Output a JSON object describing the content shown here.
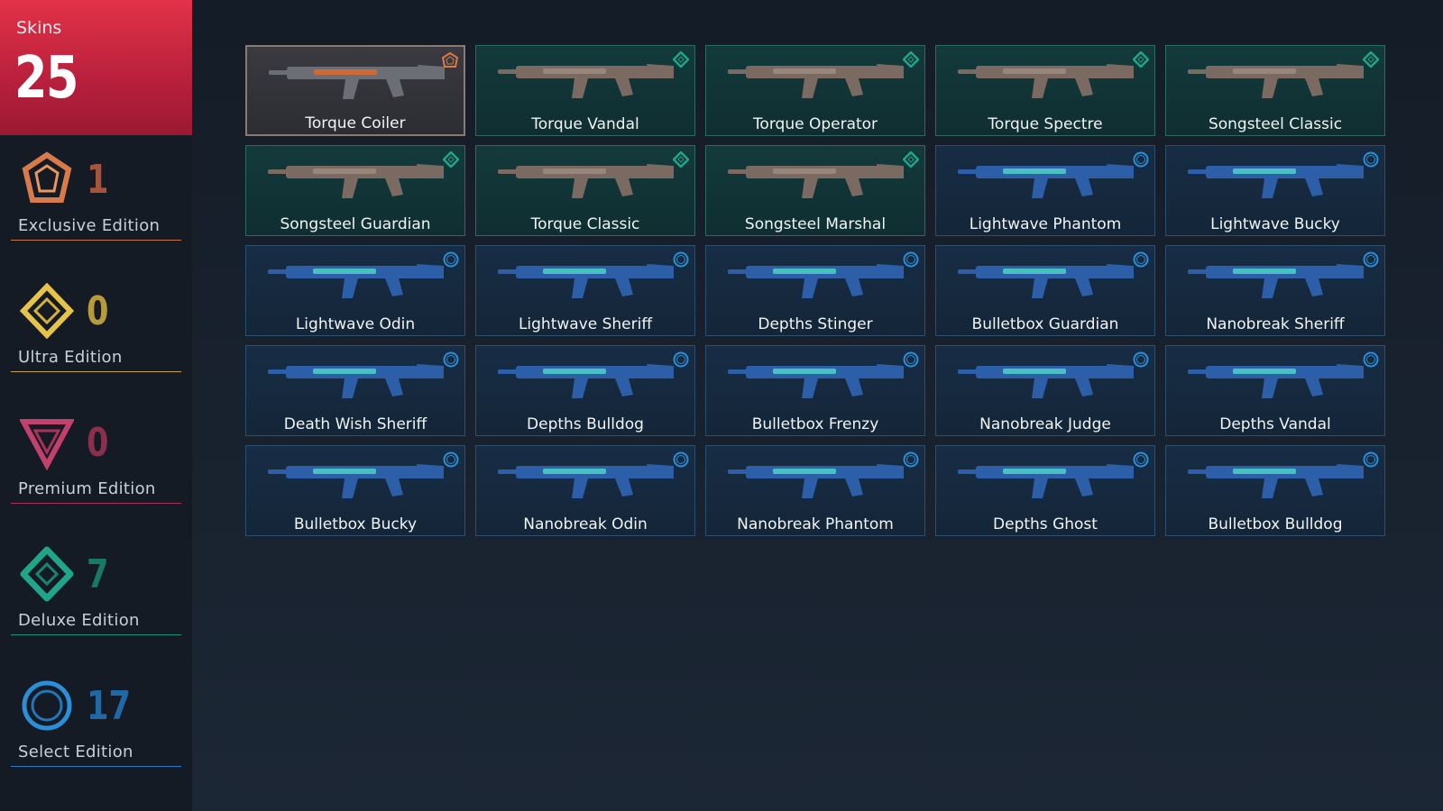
{
  "header": {
    "label": "Skins",
    "count": "25"
  },
  "tiers": [
    {
      "count": "1",
      "label": "Exclusive Edition",
      "color": "#d97a4a",
      "icon": "exclusive-edition-icon"
    },
    {
      "count": "0",
      "label": "Ultra Edition",
      "color": "#e6c44a",
      "icon": "ultra-edition-icon"
    },
    {
      "count": "0",
      "label": "Premium Edition",
      "color": "#c2416c",
      "icon": "premium-edition-icon"
    },
    {
      "count": "7",
      "label": "Deluxe Edition",
      "color": "#1fa58a",
      "icon": "deluxe-edition-icon"
    },
    {
      "count": "17",
      "label": "Select Edition",
      "color": "#2b8ed6",
      "icon": "select-edition-icon"
    }
  ],
  "skins": [
    {
      "name": "Torque Coiler",
      "tier": "exclusive"
    },
    {
      "name": "Torque Vandal",
      "tier": "deluxe"
    },
    {
      "name": "Torque Operator",
      "tier": "deluxe"
    },
    {
      "name": "Torque Spectre",
      "tier": "deluxe"
    },
    {
      "name": "Songsteel Classic",
      "tier": "deluxe"
    },
    {
      "name": "Songsteel Guardian",
      "tier": "deluxe"
    },
    {
      "name": "Torque Classic",
      "tier": "deluxe"
    },
    {
      "name": "Songsteel Marshal",
      "tier": "deluxe"
    },
    {
      "name": "Lightwave Phantom",
      "tier": "select"
    },
    {
      "name": "Lightwave Bucky",
      "tier": "select"
    },
    {
      "name": "Lightwave Odin",
      "tier": "select"
    },
    {
      "name": "Lightwave Sheriff",
      "tier": "select"
    },
    {
      "name": "Depths Stinger",
      "tier": "select"
    },
    {
      "name": "Bulletbox Guardian",
      "tier": "select"
    },
    {
      "name": "Nanobreak Sheriff",
      "tier": "select"
    },
    {
      "name": "Death Wish Sheriff",
      "tier": "select"
    },
    {
      "name": "Depths Bulldog",
      "tier": "select"
    },
    {
      "name": "Bulletbox Frenzy",
      "tier": "select"
    },
    {
      "name": "Nanobreak Judge",
      "tier": "select"
    },
    {
      "name": "Depths Vandal",
      "tier": "select"
    },
    {
      "name": "Bulletbox Bucky",
      "tier": "select"
    },
    {
      "name": "Nanobreak Odin",
      "tier": "select"
    },
    {
      "name": "Nanobreak Phantom",
      "tier": "select"
    },
    {
      "name": "Depths Ghost",
      "tier": "select"
    },
    {
      "name": "Bulletbox Bulldog",
      "tier": "select"
    }
  ],
  "colors": {
    "exclusive": "#d97a4a",
    "deluxe": "#1fa58a",
    "select": "#2b8ed6",
    "accent_red": "#e23248"
  }
}
